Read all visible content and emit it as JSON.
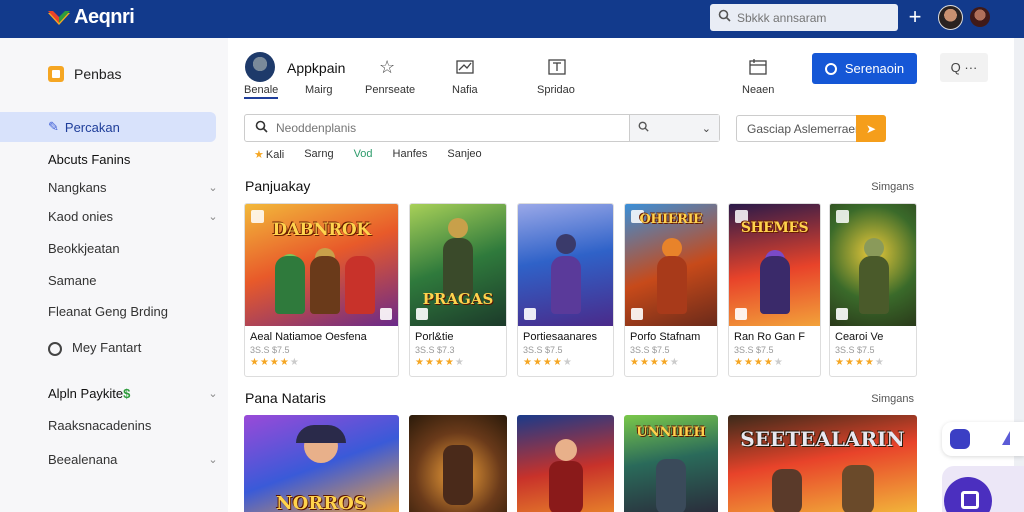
{
  "app": {
    "title": "Aeqnri"
  },
  "topbar": {
    "search_placeholder": "Sbkkk annsaram",
    "plus_label": "+"
  },
  "sidebar": {
    "header": "Penbas",
    "active": "Percakan",
    "items": [
      {
        "label": "Abcuts Fanins",
        "chevron": false
      },
      {
        "label": "Nangkans",
        "chevron": true
      },
      {
        "label": "Kaod onies",
        "chevron": true
      },
      {
        "label": "Beokkjeatan",
        "chevron": false
      },
      {
        "label": "Samane",
        "chevron": false
      },
      {
        "label": "Fleanat Geng Brding",
        "chevron": false
      },
      {
        "label": "Mey Fantart",
        "chevron": false
      },
      {
        "label": "Alpln Paykite",
        "dollar": "$",
        "chevron": true
      },
      {
        "label": "Raaksnacadenins",
        "chevron": false
      },
      {
        "label": "Beealenana",
        "chevron": true
      }
    ]
  },
  "header": {
    "profile_name": "Appkpain",
    "tabs": [
      "Benale",
      "Mairg",
      "Penrseate",
      "Nafia",
      "Spridao",
      "Neaen"
    ],
    "primary_button": "Serenaoin",
    "more_button": "Q ···"
  },
  "search": {
    "placeholder": "Neoddenplanis",
    "side_placeholder": "Gasciap Aslemerraen"
  },
  "chips": [
    "Kali",
    "Sarng",
    "Vod",
    "Hanfes",
    "Sanjeo"
  ],
  "sections": [
    {
      "title": "Panjuakay",
      "link": "Simgans"
    },
    {
      "title": "Pana Nataris",
      "link": "Simgans"
    }
  ],
  "cards": [
    {
      "art_title": "DABNROK",
      "name": "Aeal Natiamoe Oesfena",
      "sub": "3S.S $7.5",
      "rating": 4,
      "colors": [
        "#e85a2a",
        "#f2b93b",
        "#6a2a8a"
      ]
    },
    {
      "art_title": "PRAGAS",
      "name": "Porl&tie",
      "sub": "3S.S $7.3",
      "rating": 4,
      "colors": [
        "#2f7a3c",
        "#a8d058",
        "#1c3a2a"
      ]
    },
    {
      "art_title": "",
      "name": "Portiesaanares",
      "sub": "3S.S $7.5",
      "rating": 4,
      "colors": [
        "#2f62c8",
        "#9aa8e8",
        "#4a2a8a"
      ]
    },
    {
      "art_title": "OHIERIE",
      "name": "Porfo Stafnam",
      "sub": "3S.S $7.5",
      "rating": 4,
      "colors": [
        "#3a8fd8",
        "#c74a1a",
        "#6a2a1a"
      ]
    },
    {
      "art_title": "SHEMES",
      "name": "Ran Ro Gan F",
      "sub": "3S.S $7.5",
      "rating": 4,
      "colors": [
        "#2a1a4a",
        "#e8432a",
        "#f2a23a"
      ]
    },
    {
      "art_title": "",
      "name": "Cearoi Ve",
      "sub": "3S.S $7.5",
      "rating": 4,
      "colors": [
        "#3a6a2a",
        "#e8c83a",
        "#2a3a1a"
      ]
    }
  ],
  "row2": [
    {
      "art_title": "NORROS",
      "colors": [
        "#3a5ad8",
        "#9a4ad8",
        "#f2a23a"
      ]
    },
    {
      "art_title": "",
      "colors": [
        "#f2a23a",
        "#6a3a1a",
        "#2a1a0a"
      ]
    },
    {
      "art_title": "",
      "colors": [
        "#1a3a8a",
        "#c8322a",
        "#e8832a"
      ]
    },
    {
      "art_title": "UNNIIEH",
      "colors": [
        "#2a6a5a",
        "#7ac84a",
        "#2a2a3a"
      ]
    },
    {
      "art_title": "SEETEALARIN",
      "colors": [
        "#e8432a",
        "#f2b93b",
        "#3a2a1a"
      ]
    }
  ],
  "colors": {
    "topbar": "#123a8c",
    "primary": "#1557d6",
    "accent": "#f59e1b",
    "active_bg": "#d8e2fb"
  }
}
